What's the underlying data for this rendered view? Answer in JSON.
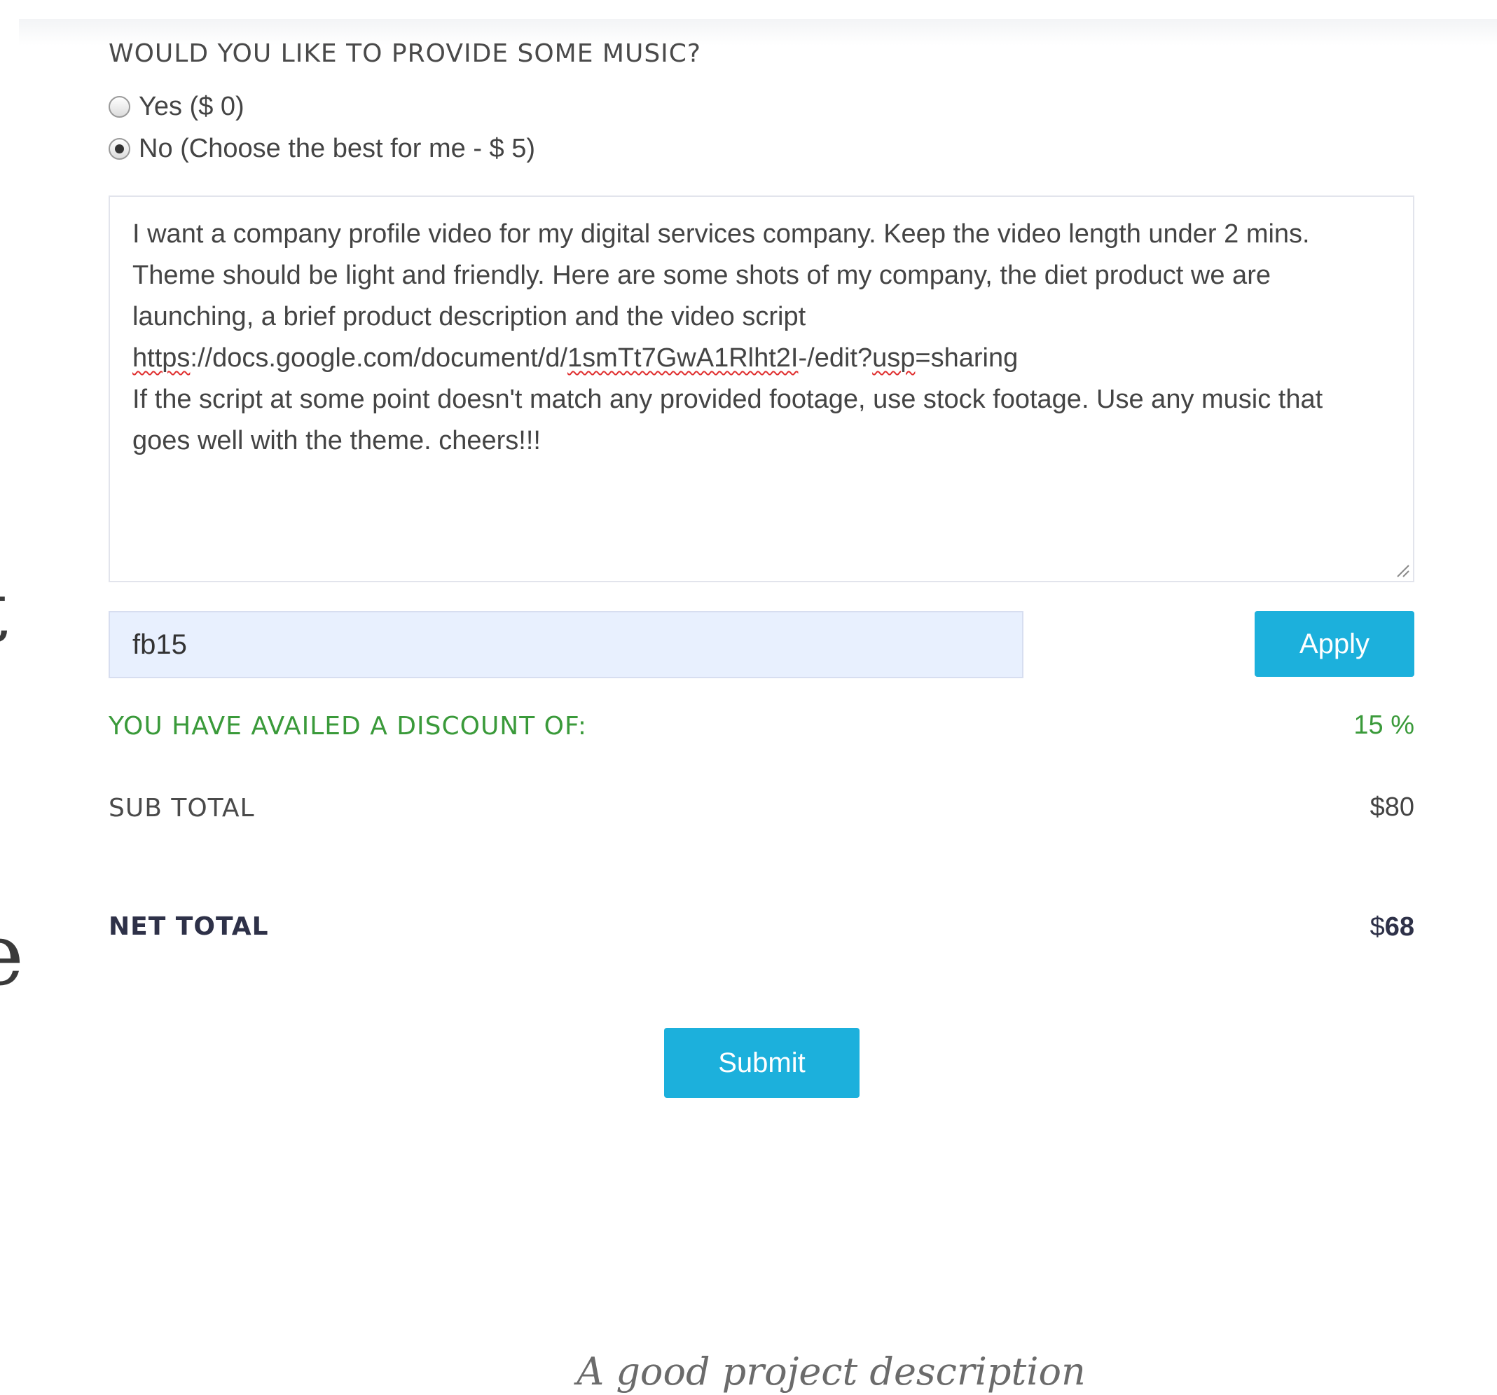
{
  "music_question": {
    "label": "WOULD YOU LIKE TO PROVIDE SOME MUSIC?",
    "options": [
      {
        "label": "Yes ($ 0)",
        "selected": false
      },
      {
        "label": "No (Choose the best for me - $ 5)",
        "selected": true
      }
    ]
  },
  "description": {
    "lines": [
      "I want a company profile video for my digital services company. Keep the video length under 2 mins.",
      "Theme should be light and friendly. Here are some shots of my company, the diet product we are",
      "launching, a brief product description and the video script",
      "https://docs.google.com/document/d/1smTt7GwA1Rlht2I-/edit?usp=sharing",
      "If the script at some point doesn't match any provided footage, use stock footage. Use any  music that",
      "goes well with the theme. cheers!!!"
    ]
  },
  "coupon": {
    "value": "fb15",
    "apply_label": "Apply"
  },
  "summary": {
    "discount_label": "YOU HAVE AVAILED A DISCOUNT OF:",
    "discount_value": "15 %",
    "subtotal_label": "SUB TOTAL",
    "subtotal_value": "$80",
    "net_label": "NET TOTAL",
    "net_currency": "$",
    "net_amount": "68"
  },
  "submit_label": "Submit",
  "caption": "A good project description",
  "colors": {
    "accent": "#1cb0dc",
    "discount_green": "#3a9a3a",
    "input_bg": "#e8f0fe",
    "net_text": "#2e3148"
  }
}
